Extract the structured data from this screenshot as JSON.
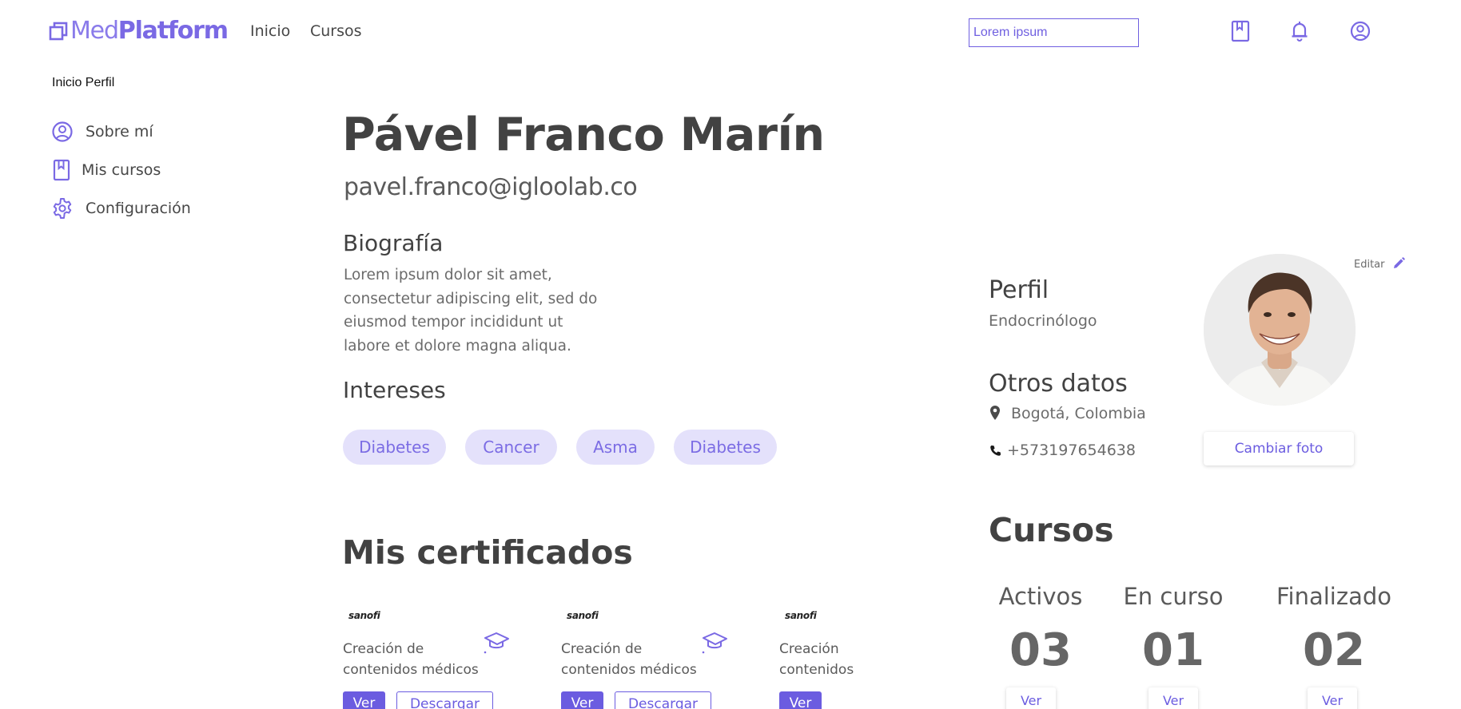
{
  "brand": {
    "name_light": "Med",
    "name_bold": "Platform"
  },
  "nav": {
    "items": [
      {
        "label": "Inicio"
      },
      {
        "label": "Cursos"
      }
    ]
  },
  "search": {
    "value": "Lorem ipsum"
  },
  "header_icons": [
    "bookmark-icon",
    "bell-icon",
    "user-circle-icon"
  ],
  "breadcrumb": "Inicio Perfil",
  "sidebar": {
    "items": [
      {
        "label": "Sobre mí",
        "icon": "user-circle-icon"
      },
      {
        "label": "Mis cursos",
        "icon": "bookmark-icon"
      },
      {
        "label": "Configuración",
        "icon": "gear-icon"
      }
    ]
  },
  "profile": {
    "name": "Pável Franco Marín",
    "email": "pavel.franco@igloolab.co",
    "bio_title": "Biografía",
    "bio": "Lorem ipsum dolor sit amet, consectetur adipiscing elit, sed do eiusmod tempor incididunt ut labore et dolore magna aliqua.",
    "interests_title": "Intereses",
    "interests": [
      "Diabetes",
      "Cancer",
      "Asma",
      "Diabetes"
    ]
  },
  "certificates": {
    "title": "Mis certificados",
    "items": [
      {
        "brand": "sanofi",
        "line1": "Creación de",
        "line2": "contenidos médicos",
        "view": "Ver",
        "download": "Descargar"
      },
      {
        "brand": "sanofi",
        "line1": "Creación de",
        "line2": "contenidos médicos",
        "view": "Ver",
        "download": "Descargar"
      },
      {
        "brand": "sanofi",
        "line1": "Creación",
        "line2": "contenidos",
        "view": "Ver"
      }
    ]
  },
  "right": {
    "perfil_label": "Perfil",
    "perfil_value": "Endocrinólogo",
    "otros_label": "Otros datos",
    "location": "Bogotá, Colombia",
    "phone": "+573197654638",
    "edit": "Editar",
    "change_photo": "Cambiar foto"
  },
  "courses": {
    "title": "Cursos",
    "stats": [
      {
        "label": "Activos",
        "value": "03",
        "action": "Ver"
      },
      {
        "label": "En curso",
        "value": "01",
        "action": "Ver"
      },
      {
        "label": "Finalizado",
        "value": "02",
        "action": "Ver"
      }
    ]
  },
  "colors": {
    "accent": "#6b5ce0",
    "chip_bg": "#e4e1fb",
    "text": "#474747"
  }
}
